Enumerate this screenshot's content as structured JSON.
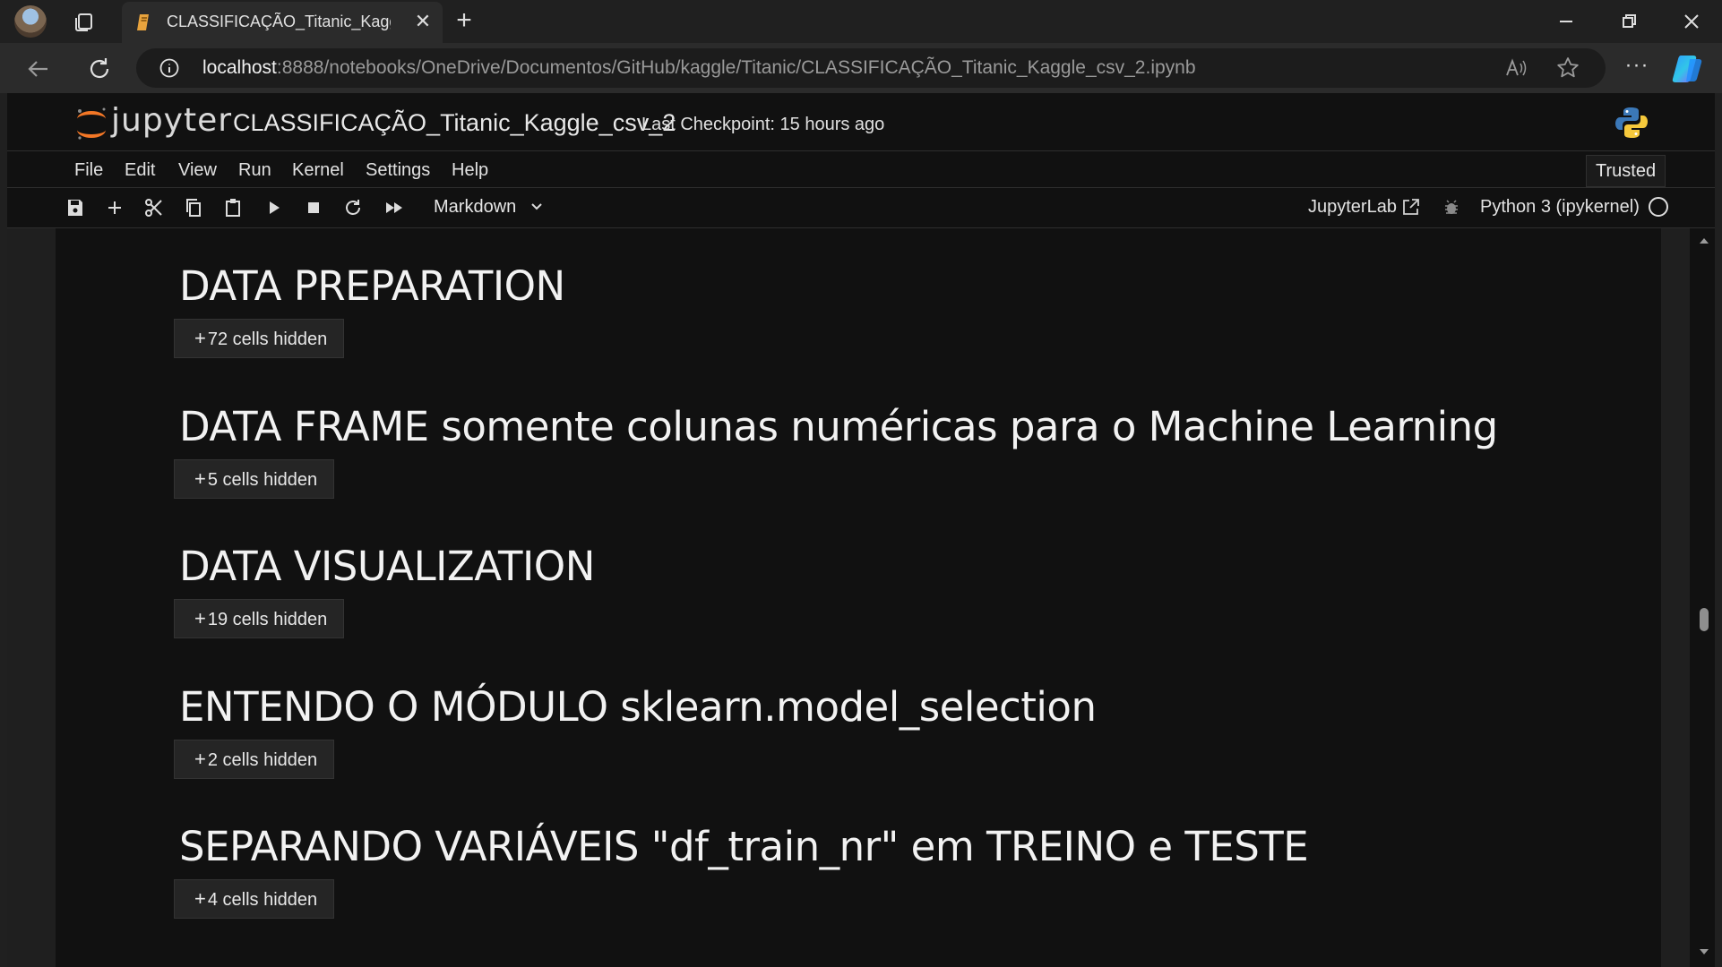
{
  "browser": {
    "tab_title": "CLASSIFICAÇÃO_Titanic_Kaggle_",
    "url_host": "localhost",
    "url_rest": ":8888/notebooks/OneDrive/Documentos/GitHub/kaggle/Titanic/CLASSIFICAÇÃO_Titanic_Kaggle_csv_2.ipynb"
  },
  "jupyter": {
    "logo_text": "jupyter",
    "notebook_name": "CLASSIFICAÇÃO_Titanic_Kaggle_csv_2",
    "checkpoint": "Last Checkpoint: 15 hours ago",
    "menu": [
      "File",
      "Edit",
      "View",
      "Run",
      "Kernel",
      "Settings",
      "Help"
    ],
    "trusted": "Trusted",
    "cell_type": "Markdown",
    "jupyterlab_link": "JupyterLab",
    "kernel": "Python 3 (ipykernel)"
  },
  "sections": [
    {
      "heading": "DATA PREPARATION",
      "hidden": "72 cells hidden"
    },
    {
      "heading": "DATA FRAME somente colunas numéricas para o Machine Learning",
      "hidden": "5 cells hidden"
    },
    {
      "heading": "DATA VISUALIZATION",
      "hidden": "19 cells hidden"
    },
    {
      "heading": "ENTENDO O MÓDULO sklearn.model_selection",
      "hidden": "2 cells hidden"
    },
    {
      "heading": "SEPARANDO VARIÁVEIS \"df_train_nr\" em TREINO e TESTE",
      "hidden": "4 cells hidden"
    }
  ],
  "colors": {
    "jupyter_orange": "#f37726",
    "tab_favicon": "#e8a33d"
  }
}
